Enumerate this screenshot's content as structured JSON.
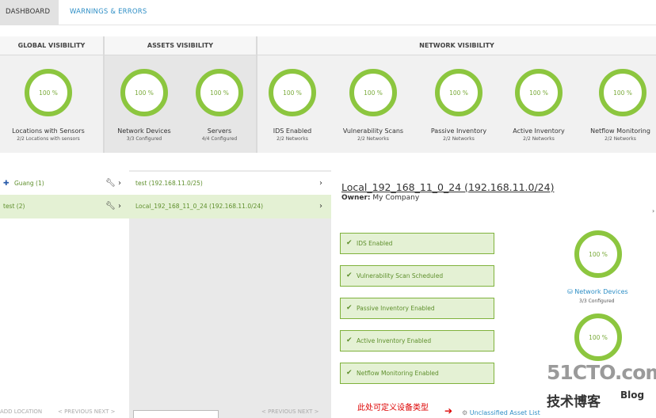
{
  "tabs": {
    "dashboard": "DASHBOARD",
    "warnings": "WARNINGS & ERRORS"
  },
  "visibility": {
    "headers": {
      "global": "GLOBAL VISIBILITY",
      "assets": "ASSETS VISIBILITY",
      "network": "NETWORK VISIBILITY"
    },
    "items": [
      {
        "value": "100 %",
        "label": "Locations with Sensors",
        "sub": "2/2 Locations with sensors",
        "percent": 100
      },
      {
        "value": "100 %",
        "label": "Network Devices",
        "sub": "3/3 Configured",
        "percent": 100
      },
      {
        "value": "100 %",
        "label": "Servers",
        "sub": "4/4 Configured",
        "percent": 100
      },
      {
        "value": "100 %",
        "label": "IDS Enabled",
        "sub": "2/2 Networks",
        "percent": 100
      },
      {
        "value": "100 %",
        "label": "Vulnerability Scans",
        "sub": "2/2 Networks",
        "percent": 100
      },
      {
        "value": "100 %",
        "label": "Passive Inventory",
        "sub": "2/2 Networks",
        "percent": 100
      },
      {
        "value": "100 %",
        "label": "Active Inventory",
        "sub": "2/2 Networks",
        "percent": 100
      },
      {
        "value": "100 %",
        "label": "Netflow Monitoring",
        "sub": "2/2 Networks",
        "percent": 100
      }
    ]
  },
  "locations": [
    {
      "label": "Guang (1)"
    },
    {
      "label": "test (2)"
    }
  ],
  "networks": [
    {
      "label": "test (192.168.11.0/25)"
    },
    {
      "label": "Local_192_168_11_0_24 (192.168.11.0/24)"
    }
  ],
  "bottom": {
    "add_location": "ADD LOCATION",
    "nav1": "< PREVIOUS  NEXT >",
    "nav2": "< PREVIOUS  NEXT >"
  },
  "detail": {
    "title": "Local_192_168_11_0_24 (192.168.11.0/24)",
    "owner_label": "Owner:",
    "owner_value": "My Company",
    "checks": [
      "IDS Enabled",
      "Vulnerability Scan Scheduled",
      "Passive Inventory Enabled",
      "Active Inventory Enabled",
      "Netflow Monitoring Enabled"
    ],
    "ring1": "100 %",
    "ring2": "100 %",
    "network_devices_link": "Network Devices",
    "network_devices_sub": "3/3 Configured",
    "annotation": "此处可定义设备类型",
    "unclassified_link": "Unclassified Asset List"
  },
  "watermark": {
    "line1": "51CTO.com",
    "line2": "技术博客",
    "line3": "Blog"
  },
  "colors": {
    "accent_green": "#8cc63f",
    "link_blue": "#2f8fc6",
    "selected_bg": "#e4f1d4"
  },
  "icons": {
    "flag": "finland-flag-icon",
    "wrench": "wrench-icon",
    "chevron": "chevron-right-icon",
    "check": "check-icon"
  }
}
